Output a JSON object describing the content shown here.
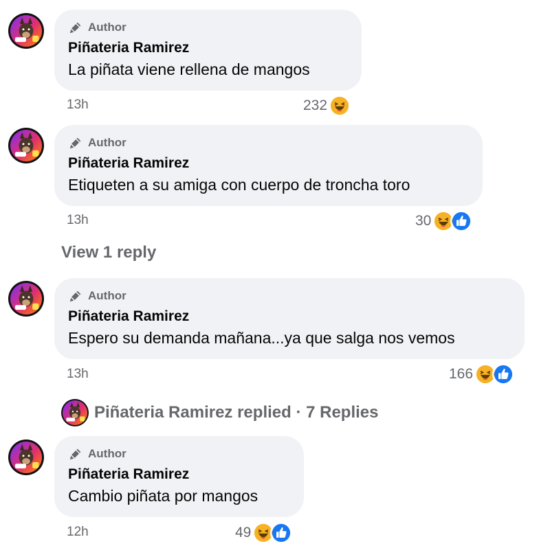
{
  "author_badge": "Author",
  "icons": {
    "author": "pencil-icon",
    "haha": "haha-emoji-icon",
    "like": "like-thumb-icon",
    "avatar": "pinata-dog-avatar"
  },
  "colors": {
    "bubble": "#f0f2f5",
    "secondary_text": "#65676b",
    "like_blue": "#1877f2",
    "haha_yellow": "#f7b125"
  },
  "comments": [
    {
      "name": "Piñateria Ramirez",
      "text": "La piñata viene rellena de mangos",
      "time": "13h",
      "reaction_count": "232",
      "reactions": [
        "haha"
      ]
    },
    {
      "name": "Piñateria Ramirez",
      "text": "Etiqueten a su amiga con cuerpo de troncha toro",
      "time": "13h",
      "reaction_count": "30",
      "reactions": [
        "haha",
        "like"
      ],
      "view_replies": "View 1 reply"
    },
    {
      "name": "Piñateria Ramirez",
      "text": "Espero su demanda mañana...ya que salga nos vemos",
      "time": "13h",
      "reaction_count": "166",
      "reactions": [
        "haha",
        "like"
      ],
      "replied_summary": "Piñateria Ramirez replied · 7 Replies"
    },
    {
      "name": "Piñateria Ramirez",
      "text": "Cambio piñata por mangos",
      "time": "12h",
      "reaction_count": "49",
      "reactions": [
        "haha",
        "like"
      ]
    }
  ]
}
